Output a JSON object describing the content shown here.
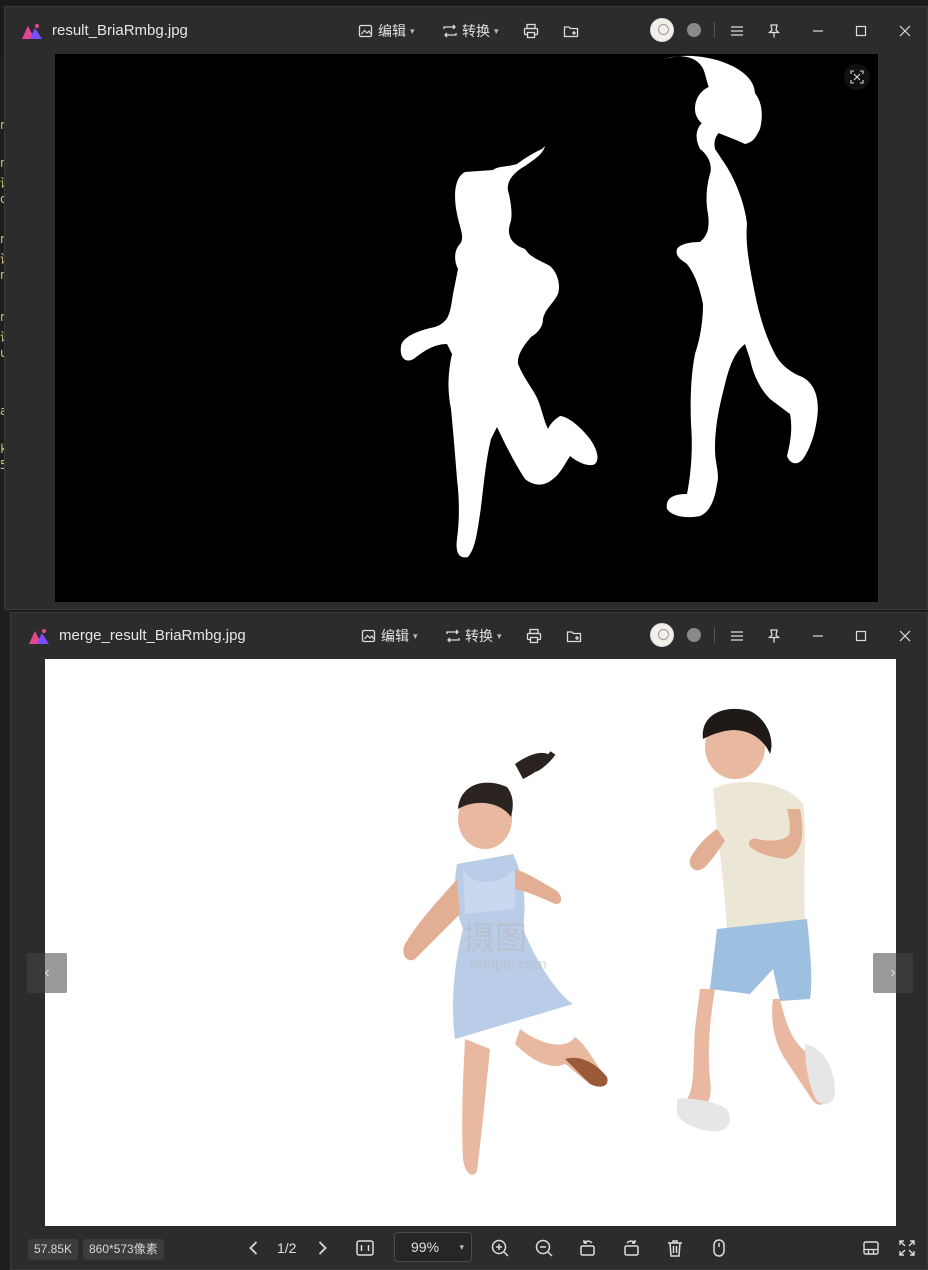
{
  "background_panel": {
    "fragments": [
      "n",
      "n",
      "讲",
      "o",
      "n",
      "讲",
      "n",
      "n",
      "讲",
      "u",
      "a",
      "k",
      "5"
    ]
  },
  "window_top": {
    "title": "result_BriaRmbg.jpg",
    "edit_label": "编辑",
    "convert_label": "转换"
  },
  "window_bottom": {
    "title": "merge_result_BriaRmbg.jpg",
    "edit_label": "编辑",
    "convert_label": "转换",
    "watermark": "摄图",
    "watermark_sub": "699pic.com",
    "status": {
      "file_size": "57.85K",
      "dimensions": "860*573像素",
      "page": "1/2",
      "zoom": "99%"
    }
  },
  "colors": {
    "window_bg": "#2c2c2c",
    "accent_logo_1": "#e5468f",
    "accent_logo_2": "#7b4dff",
    "mask_bg": "#000000",
    "mask_fg": "#ffffff"
  }
}
